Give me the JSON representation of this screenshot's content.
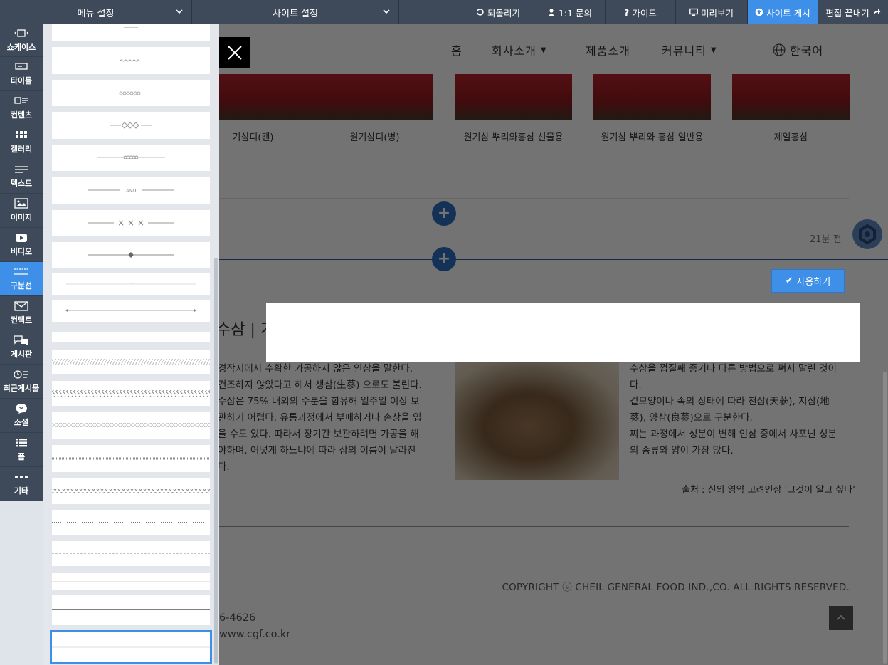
{
  "topbar": {
    "menu_settings": "메뉴 설정",
    "site_settings": "사이트 설정",
    "undo": "되돌리기",
    "inquiry": "1:1 문의",
    "guide": "가이드",
    "preview": "미리보기",
    "publish": "사이트 게시",
    "finish_editing": "편집 끝내기"
  },
  "sidebar": {
    "items": [
      {
        "label": "쇼케이스",
        "icon": "showcase-icon"
      },
      {
        "label": "타이틀",
        "icon": "title-icon"
      },
      {
        "label": "컨텐츠",
        "icon": "contents-icon"
      },
      {
        "label": "갤러리",
        "icon": "gallery-icon"
      },
      {
        "label": "텍스트",
        "icon": "text-icon"
      },
      {
        "label": "이미지",
        "icon": "image-icon"
      },
      {
        "label": "비디오",
        "icon": "video-icon"
      },
      {
        "label": "구분선",
        "icon": "divider-icon"
      },
      {
        "label": "컨택트",
        "icon": "contact-icon"
      },
      {
        "label": "게시판",
        "icon": "board-icon"
      },
      {
        "label": "최근게시물",
        "icon": "recent-posts-icon"
      },
      {
        "label": "소셜",
        "icon": "social-icon"
      },
      {
        "label": "폼",
        "icon": "form-icon"
      },
      {
        "label": "기타",
        "icon": "more-icon"
      }
    ],
    "active": "구분선"
  },
  "divider_panel": {
    "and_label": "AND",
    "times_label": "× × ×",
    "tiny_label": "· · ·",
    "selected_index": 19
  },
  "page": {
    "nav": {
      "home": "홈",
      "about": "회사소개",
      "products": "제품소개",
      "community": "커뮤니티",
      "language": "한국어"
    },
    "products": [
      "기삼디(캔)",
      "원기삼디(병)",
      "원기삼 뿌리와홍삼 선물용",
      "원기삼 뿌리와 홍삼 일반용",
      "제일홍삼"
    ],
    "timestamp": "21분 전",
    "use_button": "사용하기",
    "article_heading": "수삼 | 가",
    "article_left": [
      "경작지에서 수확한 가공하지 않은 인삼을 말한다.",
      "건조하지 않았다고 해서 생삼(生蔘) 으로도 불린다.",
      "수삼은 75% 내외의 수분을 함유해 일주일 이상 보",
      "관하기 어렵다. 유통과정에서 부패하거나 손상을 입",
      "을 수도 있다. 따라서 장기간 보관하려면 가공을 해",
      "야하며, 어떻게 하느냐에 따라 삼의 이름이 달라진",
      "다."
    ],
    "article_right": [
      "수삼을 껍질째 증기나 다른 방법으로 쪄서 말린 것이",
      "다.",
      "겉모양이나 속의 상태에 따라 천삼(天蔘), 지삼(地",
      "蔘), 양삼(良蔘)으로 구분한다.",
      "찌는 과정에서 성분이 변해 인삼 중에서 사포닌 성분",
      "의 종류와 양이 가장 많다."
    ],
    "credit": "출처 : 신의 영약 고려인삼 '그것이 알고 싶다'",
    "copyright": "COPYRIGHT ⓒ CHEIL GENERAL FOOD IND.,CO. ALL RIGHTS RESERVED.",
    "phone": "6-4626",
    "website": "www.cgf.co.kr"
  }
}
